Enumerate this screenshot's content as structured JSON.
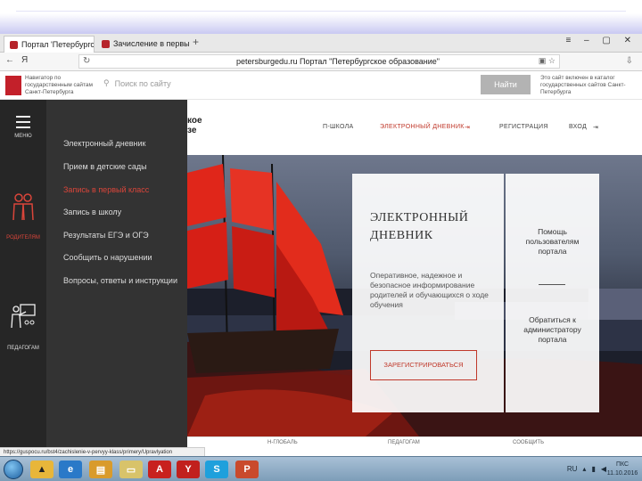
{
  "browser": {
    "tabs": [
      {
        "label": "Портал 'Петербургское",
        "active": true
      },
      {
        "label": "Зачисление в первый клас",
        "active": false
      }
    ],
    "address_url": "petersburgedu.ru  Портал \"Петербургское образование\""
  },
  "gov_header": {
    "text": "Навигатор по государственным сайтам Санкт-Петербурга",
    "search_placeholder": "Поиск по сайту",
    "search_button": "Найти",
    "promo_text": "Это сайт включен в каталог государственных сайтов Санкт-Петербурга"
  },
  "site": {
    "logo_line1": "кое",
    "logo_line2": "зе",
    "nav": [
      {
        "label": "П-ШКОЛА",
        "highlight": false
      },
      {
        "label": "ЭЛЕКТРОННЫЙ ДНЕВНИК",
        "highlight": true
      },
      {
        "label": "РЕГИСТРАЦИЯ",
        "highlight": false
      },
      {
        "label": "ВХОД",
        "highlight": false
      }
    ]
  },
  "side_menu": {
    "menu_label": "МЕНЮ",
    "parents_label": "РОДИТЕЛЯМ",
    "teachers_label": "ПЕДАГОГАМ",
    "links": [
      {
        "label": "Электронный дневник",
        "active": false
      },
      {
        "label": "Прием в детские сады",
        "active": false
      },
      {
        "label": "Запись в первый класс",
        "active": true
      },
      {
        "label": "Запись в школу",
        "active": false
      },
      {
        "label": "Результаты ЕГЭ и ОГЭ",
        "active": false
      },
      {
        "label": "Сообщить о нарушении",
        "active": false
      },
      {
        "label": "Вопросы, ответы и инструкции",
        "active": false
      }
    ]
  },
  "hero_card": {
    "title_line1": "ЭЛЕКТРОННЫЙ",
    "title_line2": "ДНЕВНИК",
    "description": "Оперативное, надежное и безопасное информирование родителей и обучающихся о ходе обучения",
    "register_button": "ЗАРЕГИСТРИРОВАТЬСЯ"
  },
  "help_card": {
    "help_text": "Помощь пользователям портала",
    "contact_text": "Обратиться к администратору портала"
  },
  "bottom_strip": [
    "Н-ГЛОБАЛЬ",
    "ПЕДАГОГАМ",
    "СООБЩИТЬ"
  ],
  "status_url": "https://guspocu.ru/bst4/zachislenie-v-pervyy-klass/primery/Upravlyation",
  "taskbar": {
    "lang": "RU",
    "time": "ПКС",
    "date": "11.10.2016"
  },
  "colors": {
    "accent_red": "#c0392b",
    "menu_dark": "#333333",
    "menu_bar": "#262626"
  }
}
